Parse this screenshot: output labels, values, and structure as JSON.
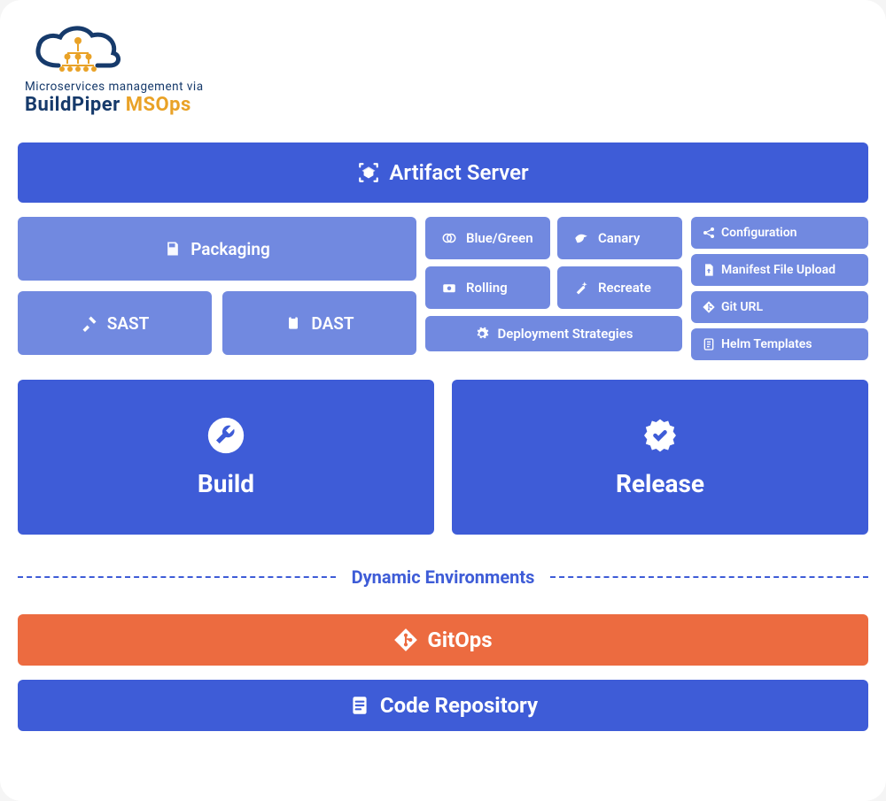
{
  "logo": {
    "tagline": "Microservices management via",
    "title_part1": "BuildPiper ",
    "title_part2": "MSOps"
  },
  "artifact": {
    "label": "Artifact Server"
  },
  "left": {
    "packaging": "Packaging",
    "sast": "SAST",
    "dast": "DAST"
  },
  "mid": {
    "blue_green": "Blue/Green",
    "canary": "Canary",
    "rolling": "Rolling",
    "recreate": "Recreate",
    "dep_strat": "Deployment Strategies"
  },
  "right": {
    "configuration": "Configuration",
    "manifest": "Manifest File Upload",
    "giturl": "Git URL",
    "helm": "Helm Templates"
  },
  "big": {
    "build": "Build",
    "release": "Release"
  },
  "divider": {
    "label": "Dynamic Environments"
  },
  "gitops": {
    "label": "GitOps"
  },
  "coderepo": {
    "label": "Code Repository"
  },
  "colors": {
    "primary": "#3e5cd7",
    "secondary": "#7189e0",
    "accent": "#ec6b40",
    "gold": "#e9a227",
    "text_dark": "#163a6b"
  }
}
